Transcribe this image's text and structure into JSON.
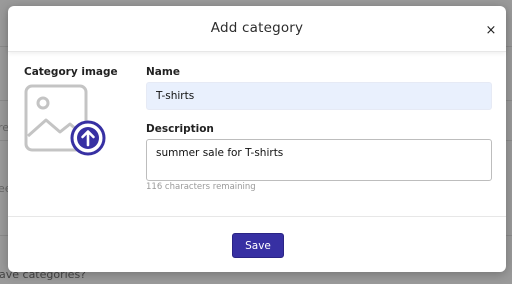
{
  "background": {
    "left_fragments": [
      "re",
      "ee"
    ],
    "bottom_text": "ave categories?"
  },
  "modal": {
    "title": "Add category",
    "close_label": "×",
    "image_label": "Category image",
    "name_label": "Name",
    "name_value": "T-shirts",
    "description_label": "Description",
    "description_value": "summer sale for T-shirts",
    "chars_remaining": "116 characters remaining",
    "save_label": "Save"
  },
  "colors": {
    "accent": "#3730a3",
    "name_input_bg": "#e9f0fd",
    "icon_gray": "#c4c4c4"
  },
  "icons": {
    "image_placeholder": "image-icon",
    "upload": "upload-arrow-icon"
  }
}
